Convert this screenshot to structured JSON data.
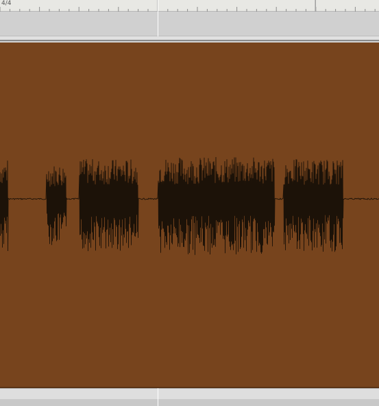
{
  "ruler": {
    "time_signature": "4/4"
  },
  "colors": {
    "region_fill": "#77441d",
    "waveform_stroke": "#1c1208",
    "ruler_bg": "#e8e8e4",
    "lane_bg": "#d0d0d0"
  },
  "waveform": {
    "bursts": [
      {
        "start": 0.0,
        "end": 0.02,
        "amplitude": 0.55
      },
      {
        "start": 0.122,
        "end": 0.175,
        "amplitude": 0.48
      },
      {
        "start": 0.208,
        "end": 0.365,
        "amplitude": 0.55
      },
      {
        "start": 0.417,
        "end": 0.725,
        "amplitude": 0.58
      },
      {
        "start": 0.747,
        "end": 0.905,
        "amplitude": 0.55
      }
    ]
  }
}
